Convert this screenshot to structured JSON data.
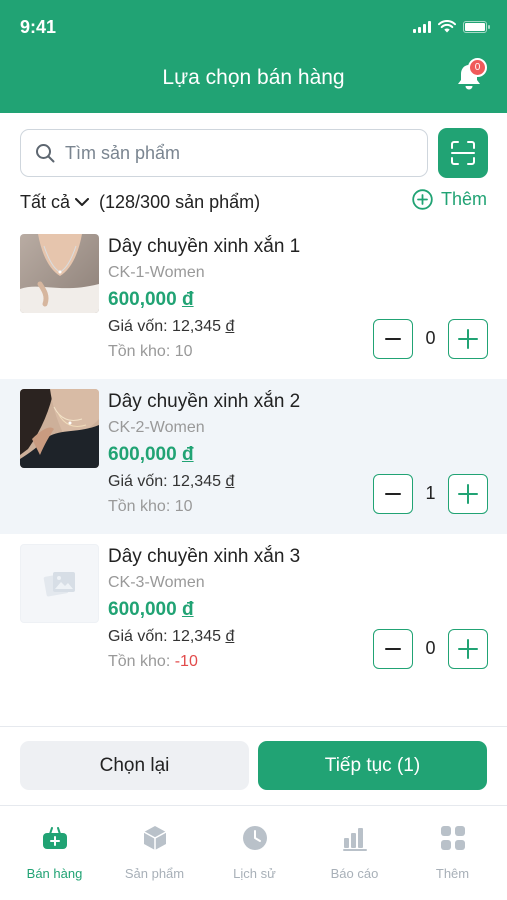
{
  "status_bar": {
    "time": "9:41"
  },
  "header": {
    "title": "Lựa chọn bán hàng",
    "notification_count": "0"
  },
  "search": {
    "placeholder": "Tìm sản phẩm"
  },
  "filter": {
    "category_label": "Tất cả",
    "count_label": "(128/300 sản phẩm)",
    "add_label": "Thêm"
  },
  "products": [
    {
      "name": "Dây chuyền xinh xắn 1",
      "sku": "CK-1-Women",
      "price": "600,000",
      "currency": "đ",
      "cost_label": "Giá vốn:",
      "cost_value": "12,345",
      "stock_label": "Tồn kho:",
      "stock_value": "10",
      "quantity": "0"
    },
    {
      "name": "Dây chuyền xinh xắn 2",
      "sku": "CK-2-Women",
      "price": "600,000",
      "currency": "đ",
      "cost_label": "Giá vốn:",
      "cost_value": "12,345",
      "stock_label": "Tồn kho:",
      "stock_value": "10",
      "quantity": "1"
    },
    {
      "name": "Dây chuyền xinh xắn 3",
      "sku": "CK-3-Women",
      "price": "600,000",
      "currency": "đ",
      "cost_label": "Giá vốn:",
      "cost_value": "12,345",
      "stock_label": "Tồn kho:",
      "stock_value": "-10",
      "quantity": "0"
    }
  ],
  "actions": {
    "reset_label": "Chọn lại",
    "continue_label": "Tiếp tục (1)"
  },
  "nav": {
    "items": [
      {
        "label": "Bán hàng",
        "icon": "shopping-basket-icon",
        "active": true
      },
      {
        "label": "Sản phẩm",
        "icon": "box-icon",
        "active": false
      },
      {
        "label": "Lịch sử",
        "icon": "clock-icon",
        "active": false
      },
      {
        "label": "Báo cáo",
        "icon": "bar-chart-icon",
        "active": false
      },
      {
        "label": "Thêm",
        "icon": "grid-icon",
        "active": false
      }
    ]
  },
  "colors": {
    "primary": "#21a374",
    "negative": "#e24b4b",
    "highlight_row": "#f1f5f9",
    "muted_text": "#999999"
  }
}
